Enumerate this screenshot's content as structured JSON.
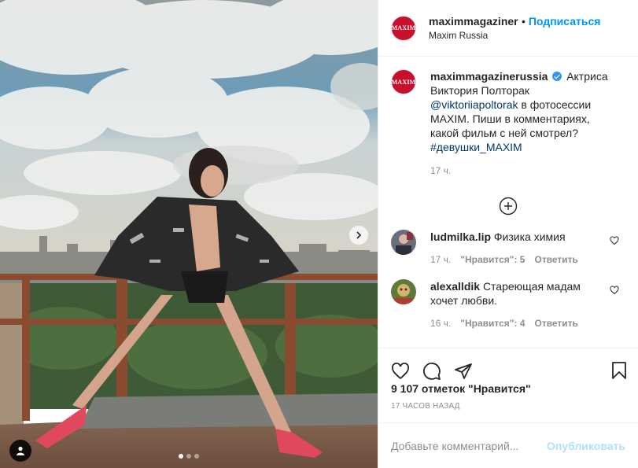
{
  "header": {
    "username": "maximmagazinerus",
    "separator": "•",
    "follow_label": "Подписаться",
    "location": "Maxim Russia",
    "avatar_text": "MAXIM"
  },
  "caption": {
    "username": "maximmagazinerussia",
    "text_1": "Актриса Виктория Полторак",
    "mention": "@viktoriiapoltorak",
    "text_2": "в фотосессии MAXIM. Пиши в комментариях, какой фильм с ней смотрел?",
    "hashtag": "#девушки_MAXIM",
    "time": "17 ч."
  },
  "comments": [
    {
      "username": "ludmilka.lip",
      "text": "Физика химия",
      "time": "17 ч.",
      "likes": "\"Нравится\": 5",
      "reply": "Ответить"
    },
    {
      "username": "alexalldik",
      "text": "Стареющая мадам хочет любви.",
      "time": "16 ч.",
      "likes": "\"Нравится\": 4",
      "reply": "Ответить"
    }
  ],
  "likes_text": "9 107 отметок \"Нравится\"",
  "post_age": "17 ЧАСОВ НАЗАД",
  "add_comment": {
    "placeholder": "Добавьте комментарий...",
    "post_label": "Опубликовать"
  },
  "carousel": {
    "current": 1,
    "total": 3
  },
  "colors": {
    "accent": "#0095f6",
    "brand_red": "#c8102e",
    "muted": "#8e8e8e",
    "post_disabled": "#b2dffc"
  },
  "icons": [
    "chevron-right-icon",
    "user-tag-icon",
    "plus-circle-icon",
    "heart-icon",
    "comment-icon",
    "share-icon",
    "bookmark-icon"
  ]
}
